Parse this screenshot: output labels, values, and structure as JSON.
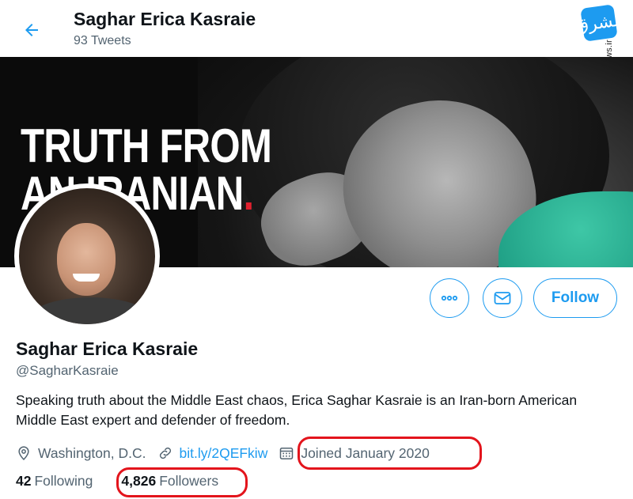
{
  "header": {
    "title": "Saghar Erica Kasraie",
    "tweet_count": "93 Tweets",
    "back_icon": "arrow-left-icon"
  },
  "watermark": {
    "logo_text": "مشرق",
    "site": "mashreghnews.ir"
  },
  "banner": {
    "line1": "TRUTH FROM",
    "line2": "AN IRANIAN",
    "line2_punct": "."
  },
  "actions": {
    "more_icon": "more-horizontal-icon",
    "message_icon": "envelope-icon",
    "follow_label": "Follow"
  },
  "profile": {
    "name": "Saghar Erica Kasraie",
    "handle": "@SagharKasraie",
    "bio": "Speaking truth about the Middle East chaos, Erica Saghar Kasraie is an Iran-born American Middle East expert and defender of freedom.",
    "location": "Washington, D.C.",
    "link": "bit.ly/2QEFkiw",
    "joined": "Joined January 2020"
  },
  "stats": {
    "following_count": "42",
    "following_label": "Following",
    "followers_count": "4,826",
    "followers_label": "Followers"
  },
  "colors": {
    "accent": "#1d9bf0",
    "annotation": "#e3141c",
    "text_primary": "#0f1419",
    "text_secondary": "#536471"
  }
}
